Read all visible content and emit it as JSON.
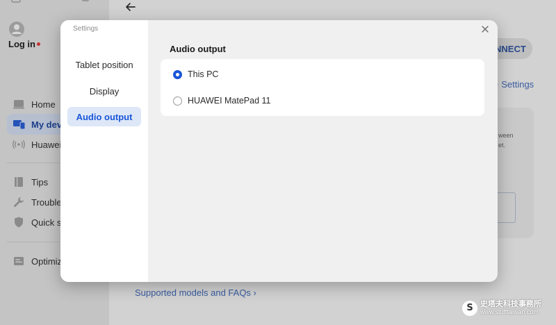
{
  "app": {
    "login": {
      "label": "Log in"
    },
    "sidebar": {
      "items": [
        {
          "label": "Home",
          "icon": "laptop-icon"
        },
        {
          "label": "My devi",
          "icon": "devices-icon",
          "active": true
        },
        {
          "label": "Huawei",
          "icon": "wireless-icon"
        },
        {
          "label": "Tips",
          "icon": "book-icon"
        },
        {
          "label": "Troubles",
          "icon": "wrench-icon"
        },
        {
          "label": "Quick se",
          "icon": "shield-icon"
        },
        {
          "label": "Optimiz",
          "icon": "optimize-icon"
        }
      ]
    },
    "main": {
      "connect_label": "NNECT",
      "settings_link": "+ Settings",
      "card_text_1": "ween",
      "card_text_2": "et.",
      "faq_link": "Supported models and FAQs ›"
    }
  },
  "modal": {
    "title": "Settings",
    "menu": [
      {
        "label": "Tablet position",
        "active": false
      },
      {
        "label": "Display",
        "active": false
      },
      {
        "label": "Audio output",
        "active": true
      }
    ],
    "section_title": "Audio output",
    "options": [
      {
        "label": "This PC",
        "selected": true
      },
      {
        "label": "HUAWEI MatePad 11",
        "selected": false
      }
    ]
  },
  "watermark": {
    "logo_letter": "S",
    "line1": "史塔夫科技事務所",
    "line2": "www.stufftaiwan.com"
  },
  "colors": {
    "accent": "#1a56d8",
    "overlay_bg": "#d2d2d2",
    "modal_bg": "#f0f0f1"
  }
}
